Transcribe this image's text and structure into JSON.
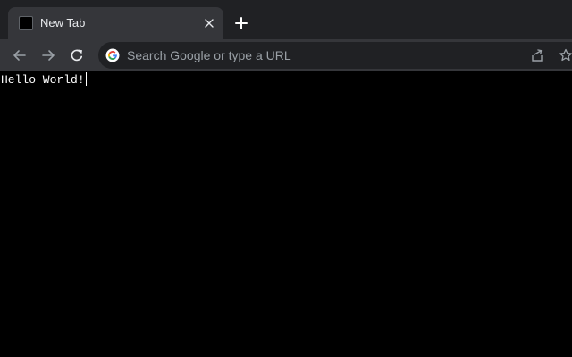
{
  "window": {
    "colors": {
      "tabstrip": "#202124",
      "tab": "#35363a",
      "omnibox": "#202124",
      "page_background": "#000000",
      "text": "#e8eaed",
      "icon": "#9aa0a6"
    }
  },
  "tabs": [
    {
      "title": "New Tab",
      "favicon": "blank-page-icon",
      "active": true
    }
  ],
  "toolbar": {
    "back_icon": "arrow-left-icon",
    "forward_icon": "arrow-right-icon",
    "reload_icon": "reload-icon",
    "omnibox": {
      "placeholder": "Search Google or type a URL",
      "value": "",
      "leading_icon": "google-g-icon"
    },
    "share_icon": "share-icon",
    "bookmark_icon": "star-icon"
  },
  "page": {
    "text": "Hello World!"
  }
}
